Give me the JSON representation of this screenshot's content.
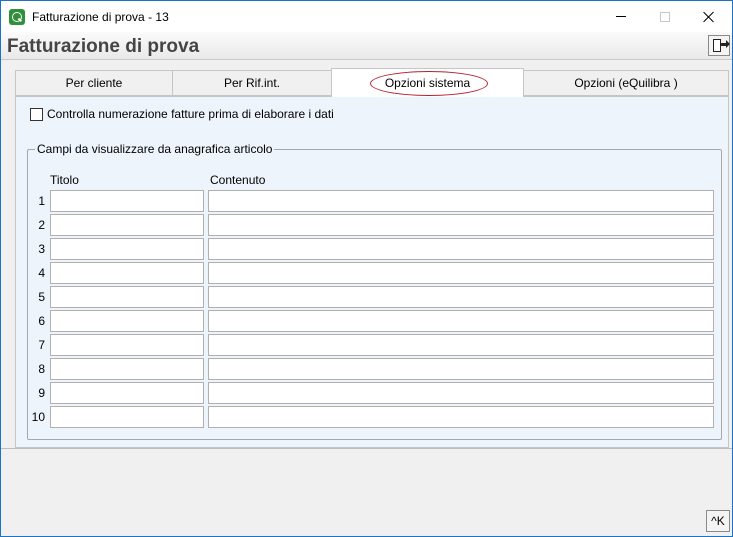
{
  "window": {
    "title": "Fatturazione di prova - 13"
  },
  "header": {
    "title": "Fatturazione di prova"
  },
  "tabs": [
    {
      "label": "Per cliente"
    },
    {
      "label": "Per Rif.int."
    },
    {
      "label": "Opzioni sistema",
      "selected": true
    },
    {
      "label": "Opzioni (eQuilibra )"
    }
  ],
  "options": {
    "check_numbering_label": "Controlla numerazione fatture prima di elaborare i dati",
    "check_numbering_checked": false
  },
  "fields_group": {
    "title": "Campi da visualizzare da anagrafica articolo",
    "col_title": "Titolo",
    "col_content": "Contenuto",
    "rows": [
      {
        "num": "1",
        "title": "",
        "content": ""
      },
      {
        "num": "2",
        "title": "",
        "content": ""
      },
      {
        "num": "3",
        "title": "",
        "content": ""
      },
      {
        "num": "4",
        "title": "",
        "content": ""
      },
      {
        "num": "5",
        "title": "",
        "content": ""
      },
      {
        "num": "6",
        "title": "",
        "content": ""
      },
      {
        "num": "7",
        "title": "",
        "content": ""
      },
      {
        "num": "8",
        "title": "",
        "content": ""
      },
      {
        "num": "9",
        "title": "",
        "content": ""
      },
      {
        "num": "10",
        "title": "",
        "content": ""
      }
    ]
  },
  "footer": {
    "shortcut_label": "^K"
  },
  "colors": {
    "accent": "#1a73c8",
    "highlight_ellipse": "#b5222e",
    "panel_bg": "#eef4fb"
  },
  "icons": {
    "app": "app-logo-icon",
    "exit": "exit-door-icon"
  }
}
